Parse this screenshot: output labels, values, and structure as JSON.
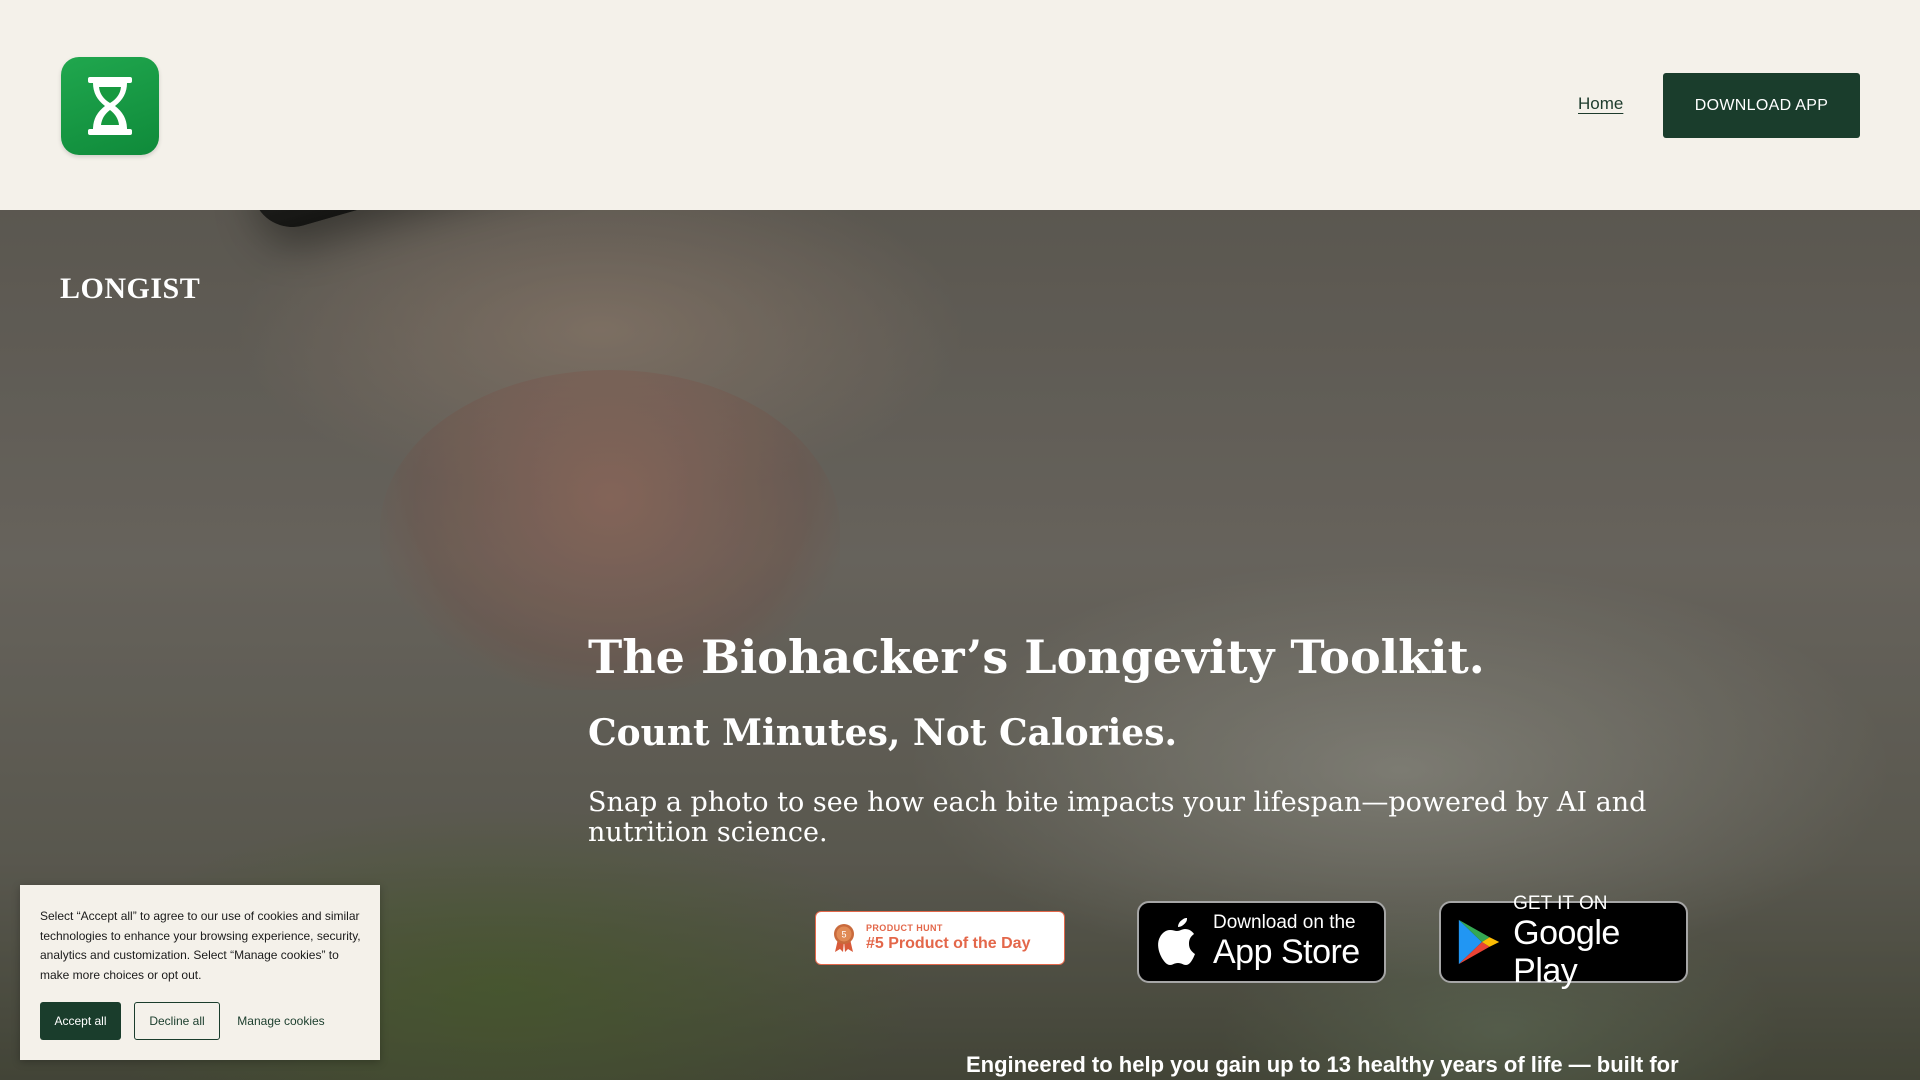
{
  "header": {
    "logo_icon": "hourglass-icon",
    "nav_home": "Home",
    "download_button": "DOWNLOAD APP"
  },
  "hero": {
    "brand": "LONGIST",
    "title": "The Biohacker’s Longevity Toolkit.",
    "subtitle": "Count Minutes, Not Calories.",
    "description": "Snap a photo to see how each bite impacts your lifespan—powered by AI and nutrition science.",
    "tagline": "Engineered to help you gain up to 13 healthy years of life — built for"
  },
  "badges": {
    "product_hunt": {
      "small": "PRODUCT HUNT",
      "big": "#5 Product of the Day",
      "medal_number": "5"
    },
    "app_store": {
      "small": "Download on the",
      "big": "App Store"
    },
    "google_play": {
      "small": "GET IT ON",
      "big": "Google Play"
    }
  },
  "cookie": {
    "text": "Select “Accept all” to agree to our use of cookies and similar technologies to enhance your browsing experience, security, analytics and customization. Select “Manage cookies” to make more choices or opt out.",
    "accept": "Accept all",
    "decline": "Decline all",
    "manage": "Manage cookies"
  },
  "colors": {
    "accent": "#1a3d2c",
    "background": "#f4f1ea",
    "logo_green": "#17993f",
    "product_hunt": "#e3674a"
  }
}
